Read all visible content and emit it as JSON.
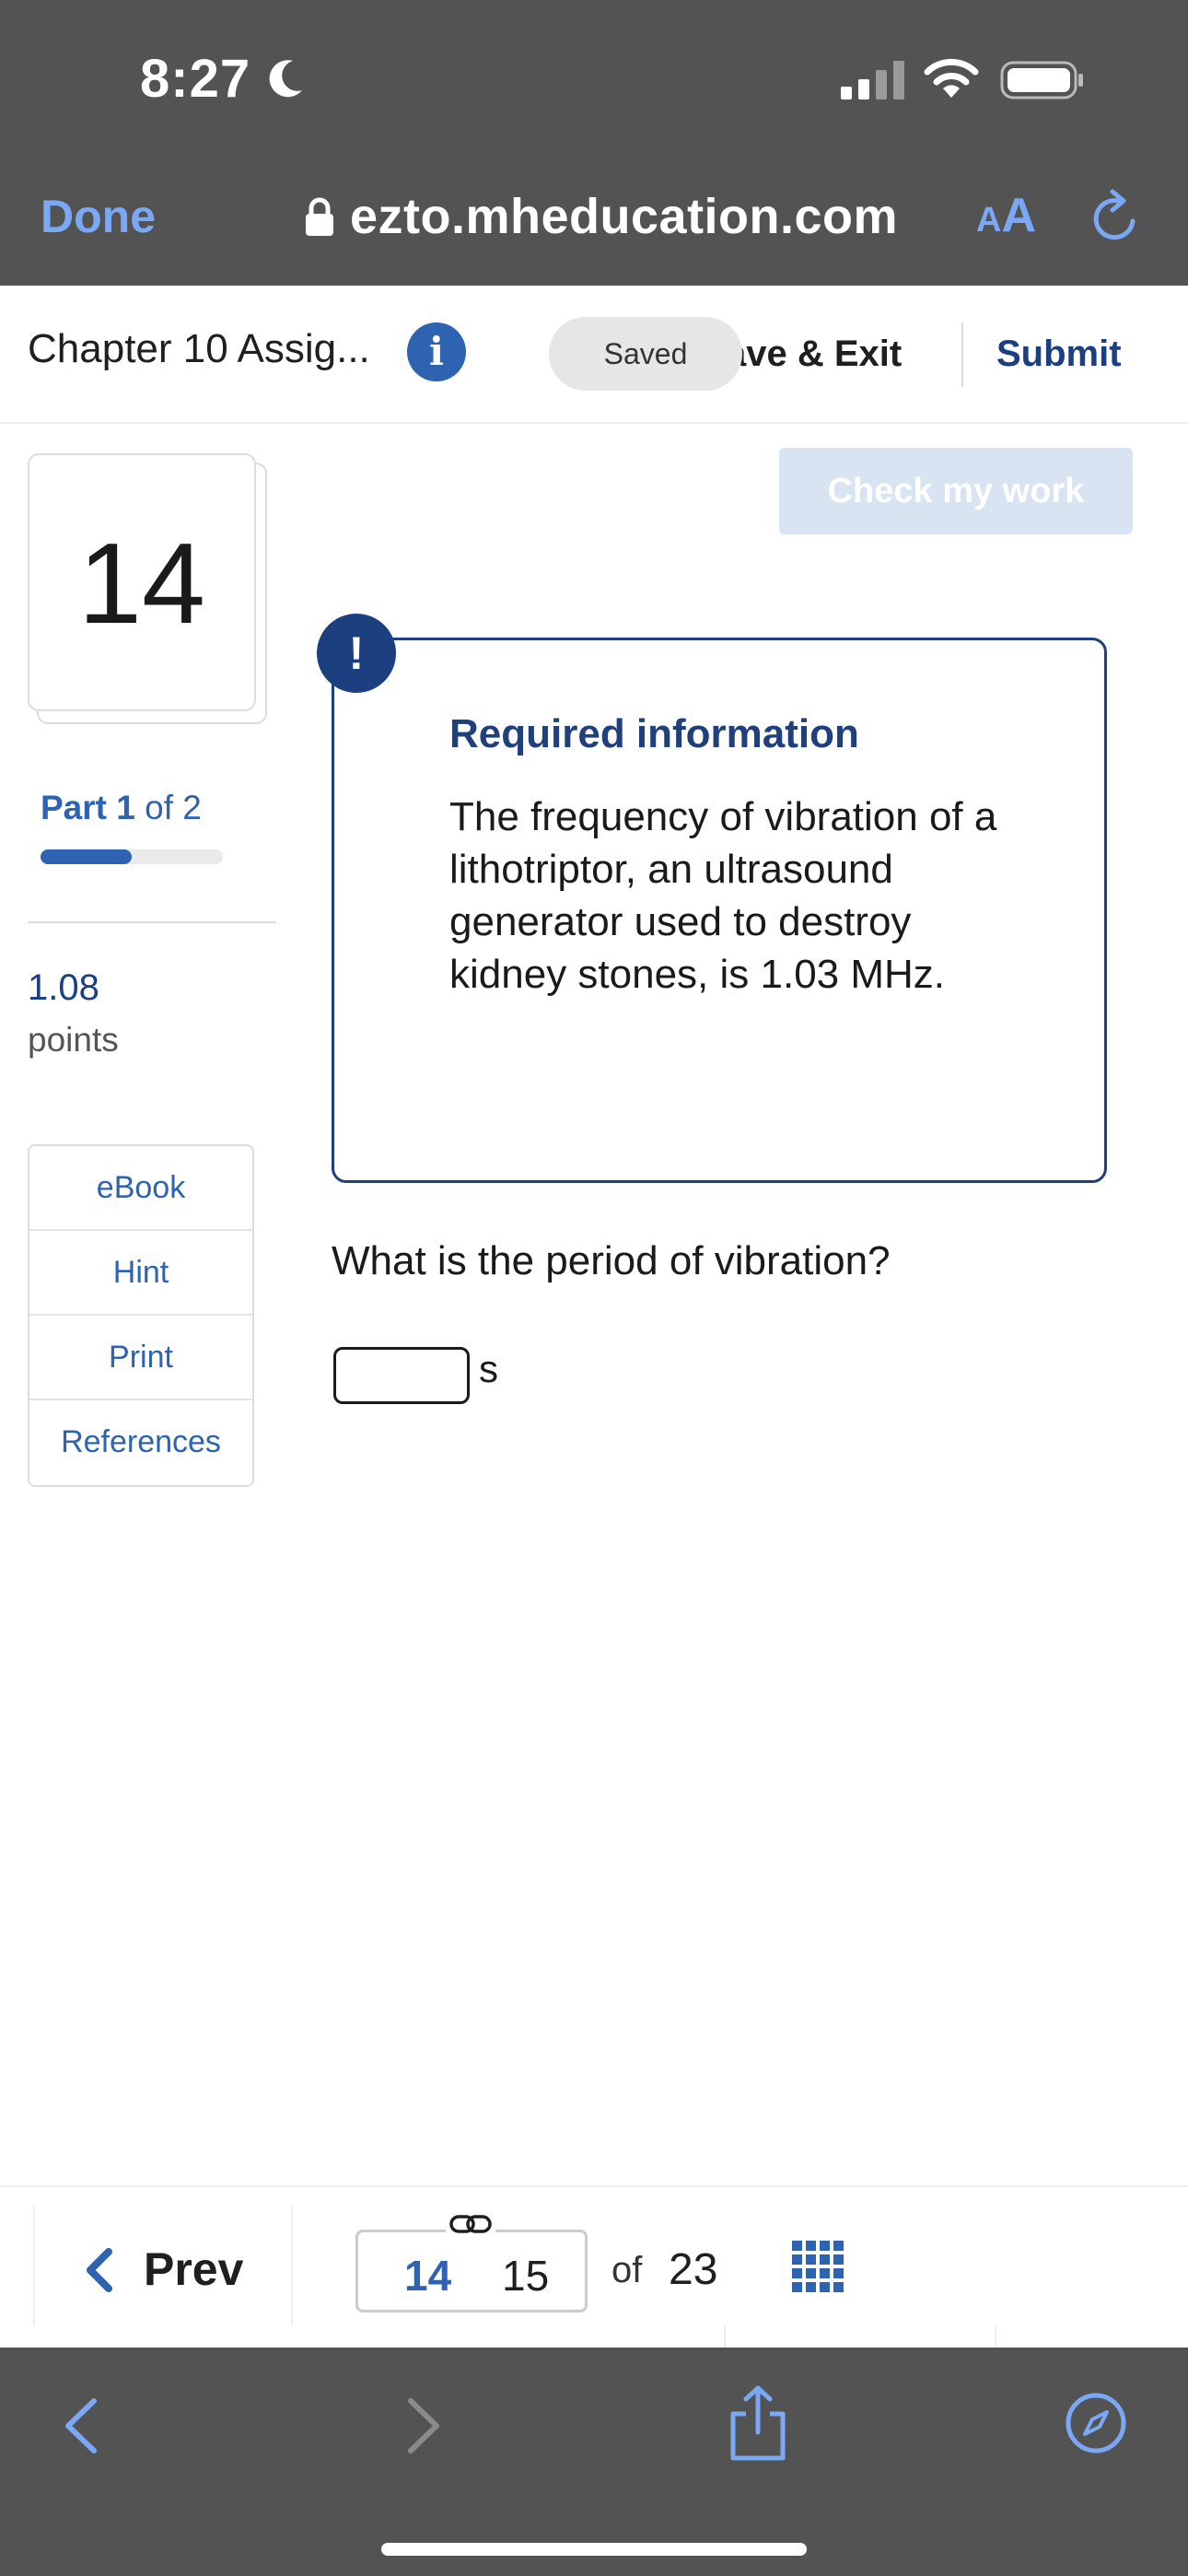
{
  "status_bar": {
    "time": "8:27"
  },
  "browser": {
    "done_label": "Done",
    "url": "ezto.mheducation.com",
    "text_size_small": "A",
    "text_size_large": "A"
  },
  "assignment": {
    "title": "Chapter 10 Assig...",
    "info_icon_glyph": "i",
    "saved_label": "Saved",
    "save_exit_label": "ave & Exit",
    "submit_label": "Submit"
  },
  "question": {
    "number": "14",
    "part_label": "Part",
    "part_current": "1",
    "part_of": "of 2",
    "part_progress": 0.5,
    "points_value": "1.08",
    "points_label": "points",
    "tools": [
      "eBook",
      "Hint",
      "Print",
      "References"
    ]
  },
  "main": {
    "check_label": "Check my work",
    "alert_glyph": "!",
    "required_title": "Required information",
    "required_text": "The frequency of vibration of a lithotriptor, an ultrasound generator used to destroy kidney stones, is 1.03 MHz.",
    "question_text": "What is the period of vibration?",
    "answer_value": "",
    "answer_unit": "s"
  },
  "pager": {
    "prev_label": "Prev",
    "current_page": "14",
    "next_page": "15",
    "of_label": "of",
    "total_pages": "23"
  },
  "colors": {
    "accent_blue": "#2d63b0",
    "dark_navy": "#1c3f80",
    "safari_link": "#7aa8f5",
    "chrome_gray": "#535353"
  },
  "icons": [
    "moon-icon",
    "signal-icon",
    "wifi-icon",
    "battery-icon",
    "lock-icon",
    "reload-icon",
    "info-icon",
    "alert-icon",
    "chevron-left-icon",
    "link-icon",
    "grid-icon",
    "back-icon",
    "forward-icon",
    "share-icon",
    "compass-icon"
  ]
}
